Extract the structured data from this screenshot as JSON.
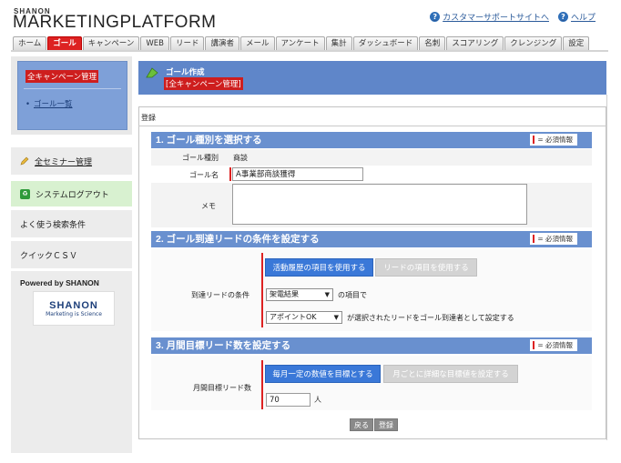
{
  "brand": {
    "top": "SHANON",
    "main": "MARKETINGPLATFORM"
  },
  "toplinks": {
    "support": "カスタマーサポートサイトへ",
    "help": "ヘルプ"
  },
  "tabs": [
    "ホーム",
    "ゴール",
    "キャンペーン",
    "WEB",
    "リード",
    "講演者",
    "メール",
    "アンケート",
    "集計",
    "ダッシュボード",
    "名刺",
    "スコアリング",
    "クレンジング",
    "設定"
  ],
  "sidebar": {
    "campaign_title": "全キャンペーン管理",
    "goal_list": "ゴール一覧",
    "seminar": "全セミナー管理",
    "syslog": "システムログアウト",
    "search": "よく使う検索条件",
    "quick": "クイックＣＳＶ",
    "powered": "Powered by SHANON",
    "logo_name": "SHANON",
    "logo_sub": "Marketing is Science"
  },
  "main": {
    "title": "ゴール作成",
    "subtitle": "[全キャンペーン管理]",
    "register_label": "登録",
    "required_text": "= 必須情報"
  },
  "sec1": {
    "heading": "1. ゴール種別を選択する",
    "type_label": "ゴール種別",
    "type_value": "商談",
    "name_label": "ゴール名",
    "name_value": "A事業部商談獲得",
    "memo_label": "メモ"
  },
  "sec2": {
    "heading": "2. ゴール到達リードの条件を設定する",
    "cond_label": "到達リードの条件",
    "btn_activity": "活動履歴の項目を使用する",
    "btn_lead": "リードの項目を使用する",
    "select1": "架電結果",
    "suffix1": "の項目で",
    "select2": "アポイントOK",
    "suffix2": "が選択されたリードをゴール到達者として設定する"
  },
  "sec3": {
    "heading": "3. 月間目標リード数を設定する",
    "target_label": "月間目標リード数",
    "btn_fixed": "毎月一定の数値を目標とする",
    "btn_detail": "月ごとに詳細な目標値を設定する",
    "value": "70",
    "unit": "人"
  },
  "buttons": {
    "back": "戻る",
    "register": "登録"
  }
}
